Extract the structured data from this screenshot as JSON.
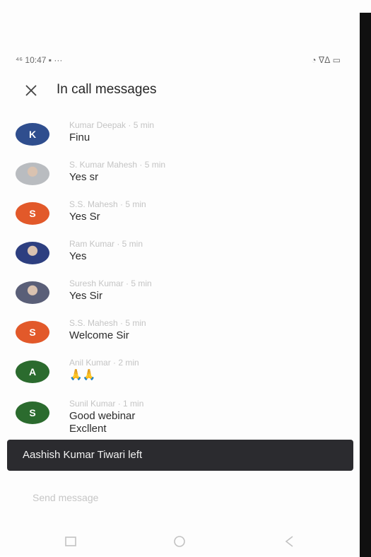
{
  "status_bar": {
    "left": "⁴⁶ 10:47 ▪ ···",
    "right": "◔ ᐁᐃ ▭"
  },
  "header": {
    "title": "In call messages",
    "close_icon": "close-icon"
  },
  "messages": [
    {
      "sender": "Kumar Deepak · 5 min",
      "text": "Finu",
      "avatar_letter": "K",
      "avatar_color": "#2f4e8e",
      "avatar_type": "letter"
    },
    {
      "sender": "S. Kumar Mahesh · 5 min",
      "text": "Yes sr",
      "avatar_letter": "",
      "avatar_color": "#b9bcc0",
      "avatar_type": "photo"
    },
    {
      "sender": "S.S. Mahesh · 5 min",
      "text": "Yes Sr",
      "avatar_letter": "S",
      "avatar_color": "#e2592a",
      "avatar_type": "letter"
    },
    {
      "sender": "Ram Kumar · 5 min",
      "text": "Yes",
      "avatar_letter": "",
      "avatar_color": "#2d3f80",
      "avatar_type": "photo"
    },
    {
      "sender": "Suresh Kumar · 5 min",
      "text": "Yes Sir",
      "avatar_letter": "",
      "avatar_color": "#5a5f78",
      "avatar_type": "photo"
    },
    {
      "sender": "S.S. Mahesh · 5 min",
      "text": "Welcome Sir",
      "avatar_letter": "S",
      "avatar_color": "#e2592a",
      "avatar_type": "letter"
    },
    {
      "sender": "Anil Kumar · 2 min",
      "text": "🙏🙏",
      "avatar_letter": "A",
      "avatar_color": "#2b6b2e",
      "avatar_type": "letter"
    },
    {
      "sender": "Sunil Kumar · 1 min",
      "text": "Good webinar\nExcllent",
      "avatar_letter": "S",
      "avatar_color": "#2b6b2e",
      "avatar_type": "letter"
    }
  ],
  "toast": {
    "text": "Aashish Kumar Tiwari left"
  },
  "composer": {
    "placeholder": "Send message"
  },
  "nav": {
    "icons": [
      "recents-icon",
      "home-icon",
      "back-icon"
    ]
  }
}
